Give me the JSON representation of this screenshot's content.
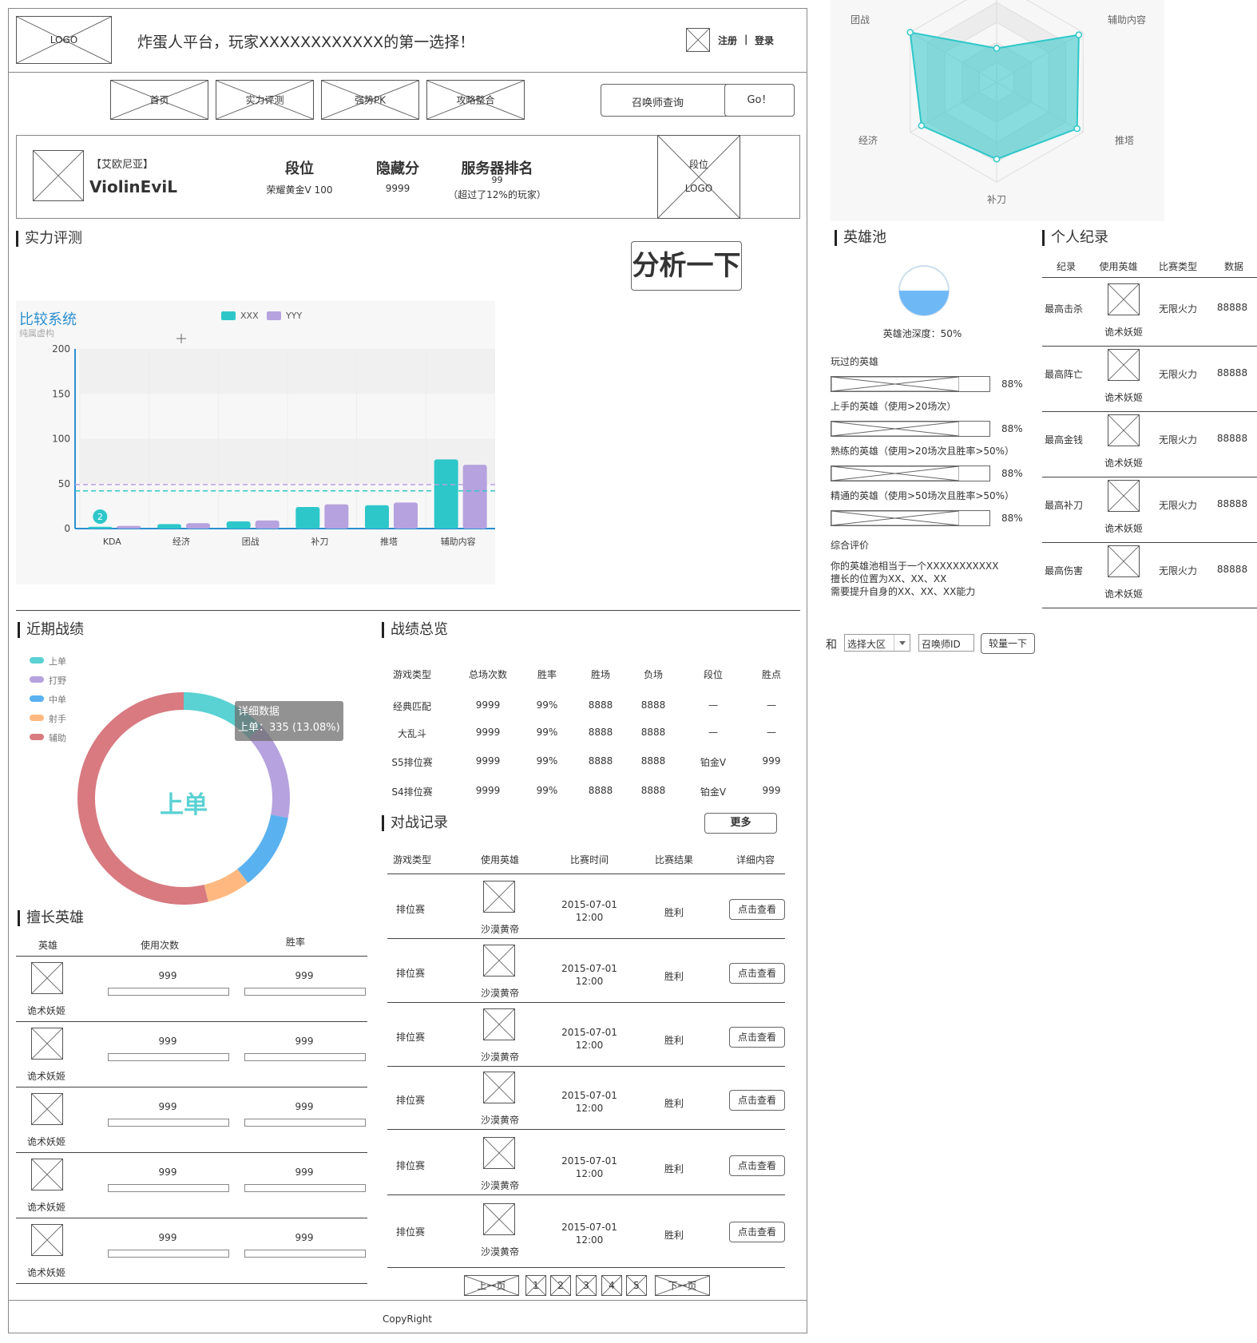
{
  "header": {
    "logo": "LOGO",
    "slogan": "炸蛋人平台，玩家XXXXXXXXXXXX的第一选择！",
    "register": "注册",
    "sep": "|",
    "login": "登录"
  },
  "nav": {
    "items": [
      {
        "label": "首页"
      },
      {
        "label": "实力评测"
      },
      {
        "label": "强势PK"
      },
      {
        "label": "攻略整合"
      }
    ],
    "search_placeholder": "召唤师查询",
    "go_label": "Go！"
  },
  "profile": {
    "server": "【艾欧尼亚】",
    "name": "ViolinEviL",
    "rank_title": "段位",
    "rank_value": "荣耀黄金V 100",
    "hidden_title": "隐藏分",
    "hidden_value": "9999",
    "server_rank_title": "服务器排名",
    "server_rank_value": "99",
    "server_rank_note": "（超过了12%的玩家）",
    "badge_line1": "段位",
    "badge_line2": "LOGO"
  },
  "evaluation": {
    "title": "实力评测",
    "analyze_button": "分析一下"
  },
  "compare_chart": {
    "title": "比较系统",
    "subtitle": "纯属虚构"
  },
  "chart_data": [
    {
      "type": "bar",
      "title": "比较系统",
      "subtitle": "纯属虚构",
      "categories": [
        "KDA",
        "经济",
        "团战",
        "补刀",
        "推塔",
        "辅助内容"
      ],
      "series": [
        {
          "name": "XXX",
          "values": [
            2,
            5,
            8,
            24,
            26,
            77
          ],
          "color": "#2ec7c9"
        },
        {
          "name": "YYY",
          "values": [
            3,
            6,
            9,
            27,
            29,
            71
          ],
          "color": "#b6a2de"
        }
      ],
      "ylim": [
        0,
        200
      ],
      "yticks": [
        "0",
        "50",
        "100",
        "150",
        "200"
      ],
      "markline_xxx": 42,
      "markline_yyy": 49,
      "markpoint_label": "2",
      "legend": "top-center",
      "grid": true
    },
    {
      "type": "radar",
      "axes": [
        "团战",
        "辅助内容",
        "推塔",
        "补刀",
        "经济"
      ],
      "values": [
        0.34,
        0.95,
        0.93,
        0.77,
        0.87,
        1.0
      ],
      "color": "#2ec7c9"
    },
    {
      "type": "pie",
      "title": "上单",
      "categories": [
        "上单",
        "打野",
        "中单",
        "射手",
        "辅助"
      ],
      "values": [
        335,
        380,
        300,
        170,
        1375
      ],
      "colors": [
        "#5ad1d3",
        "#b6a2de",
        "#5ab1ef",
        "#ffb980",
        "#d87a80"
      ],
      "tooltip_title": "详细数据",
      "tooltip_text": "上单：335 (13.08%)"
    }
  ],
  "radar": {
    "labels": [
      "团战",
      "辅助内容",
      "经济",
      "推塔",
      "补刀"
    ]
  },
  "pool": {
    "title": "英雄池",
    "depth_label": "英雄池深度：50%",
    "depth": 0.5,
    "played": "玩过的英雄",
    "handy": "上手的英雄（使用>20场次）",
    "skilled": "熟练的英雄（使用>20场次且胜率>50%）",
    "master": "精通的英雄（使用>50场次且胜率>50%）",
    "pct": "88%",
    "review_title": "综合评价",
    "review_lines": [
      "你的英雄池相当于一个XXXXXXXXXXX",
      "擅长的位置为XX、XX、XX",
      "需要提升自身的XX、XX、XX能力"
    ]
  },
  "records": {
    "title": "个人纪录",
    "headers": [
      "纪录",
      "使用英雄",
      "比赛类型",
      "数据"
    ],
    "rows": [
      {
        "name": "最高击杀",
        "hero": "诡术妖姬",
        "type": "无限火力",
        "value": "88888"
      },
      {
        "name": "最高阵亡",
        "hero": "诡术妖姬",
        "type": "无限火力",
        "value": "88888"
      },
      {
        "name": "最高金钱",
        "hero": "诡术妖姬",
        "type": "无限火力",
        "value": "88888"
      },
      {
        "name": "最高补刀",
        "hero": "诡术妖姬",
        "type": "无限火力",
        "value": "88888"
      },
      {
        "name": "最高伤害",
        "hero": "诡术妖姬",
        "type": "无限火力",
        "value": "88888"
      }
    ]
  },
  "compare": {
    "and": "和",
    "region": "选择大区",
    "summoner_id": "召唤师ID",
    "button": "较量一下"
  },
  "recent": {
    "title": "近期战绩",
    "legend": [
      "上单",
      "打野",
      "中单",
      "射手",
      "辅助"
    ],
    "center": "上单"
  },
  "best": {
    "title": "擅长英雄",
    "headers": [
      "英雄",
      "使用次数",
      "胜率"
    ],
    "rows": [
      {
        "hero": "诡术妖姬",
        "uses": "999",
        "rate": "999"
      },
      {
        "hero": "诡术妖姬",
        "uses": "999",
        "rate": "999"
      },
      {
        "hero": "诡术妖姬",
        "uses": "999",
        "rate": "999"
      },
      {
        "hero": "诡术妖姬",
        "uses": "999",
        "rate": "999"
      },
      {
        "hero": "诡术妖姬",
        "uses": "999",
        "rate": "999"
      }
    ]
  },
  "overview": {
    "title": "战绩总览",
    "headers": [
      "游戏类型",
      "总场次数",
      "胜率",
      "胜场",
      "负场",
      "段位",
      "胜点"
    ],
    "rows": [
      [
        "经典匹配",
        "9999",
        "99%",
        "8888",
        "8888",
        "—",
        "—"
      ],
      [
        "大乱斗",
        "9999",
        "99%",
        "8888",
        "8888",
        "—",
        "—"
      ],
      [
        "S5排位赛",
        "9999",
        "99%",
        "8888",
        "8888",
        "铂金V",
        "999"
      ],
      [
        "S4排位赛",
        "9999",
        "99%",
        "8888",
        "8888",
        "铂金V",
        "999"
      ]
    ]
  },
  "battles": {
    "title": "对战记录",
    "more": "更多",
    "headers": [
      "游戏类型",
      "使用英雄",
      "比赛时间",
      "比赛结果",
      "详细内容"
    ],
    "rows": [
      {
        "type": "排位赛",
        "hero": "沙漠黄帝",
        "date": "2015-07-01",
        "time": "12:00",
        "result": "胜利",
        "action": "点击查看"
      },
      {
        "type": "排位赛",
        "hero": "沙漠黄帝",
        "date": "2015-07-01",
        "time": "12:00",
        "result": "胜利",
        "action": "点击查看"
      },
      {
        "type": "排位赛",
        "hero": "沙漠黄帝",
        "date": "2015-07-01",
        "time": "12:00",
        "result": "胜利",
        "action": "点击查看"
      },
      {
        "type": "排位赛",
        "hero": "沙漠黄帝",
        "date": "2015-07-01",
        "time": "12:00",
        "result": "胜利",
        "action": "点击查看"
      },
      {
        "type": "排位赛",
        "hero": "沙漠黄帝",
        "date": "2015-07-01",
        "time": "12:00",
        "result": "胜利",
        "action": "点击查看"
      },
      {
        "type": "排位赛",
        "hero": "沙漠黄帝",
        "date": "2015-07-01",
        "time": "12:00",
        "result": "胜利",
        "action": "点击查看"
      }
    ]
  },
  "pagination": {
    "prev": "上一页",
    "pages": [
      "1",
      "2",
      "3",
      "4",
      "5"
    ],
    "next": "下一页"
  },
  "footer": {
    "copyright": "CopyRight"
  }
}
